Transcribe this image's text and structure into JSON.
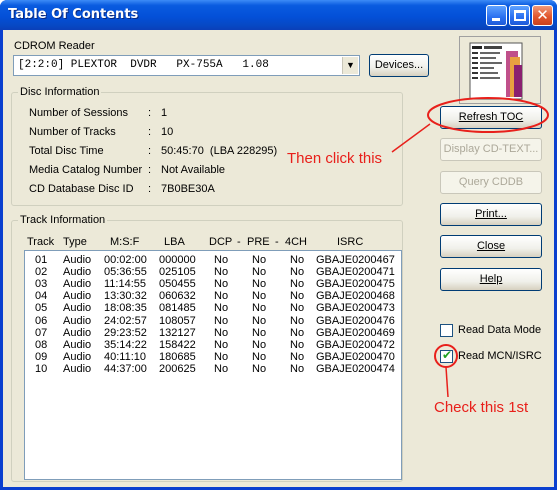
{
  "window": {
    "title": "Table Of Contents"
  },
  "cdrom": {
    "label": "CDROM Reader",
    "selected": "[2:2:0] PLEXTOR  DVDR   PX-755A   1.08",
    "devices_button": "Devices..."
  },
  "disc_info": {
    "title": "Disc Information",
    "rows": [
      {
        "label": "Number of Sessions",
        "sep": ":",
        "value": "1"
      },
      {
        "label": "Number of Tracks",
        "sep": ":",
        "value": "10"
      },
      {
        "label": "Total Disc Time",
        "sep": ":",
        "value": "50:45:70  (LBA 228295)"
      },
      {
        "label": "Media Catalog Number",
        "sep": ":",
        "value": "Not Available"
      },
      {
        "label": "CD Database Disc ID",
        "sep": ":",
        "value": "7B0BE30A"
      }
    ]
  },
  "track_info": {
    "title": "Track Information",
    "columns": {
      "track": "Track",
      "type": "Type",
      "msf": "M:S:F",
      "lba": "LBA",
      "dcp": "DCP",
      "dash1": "-",
      "pre": "PRE",
      "dash2": "-",
      "ch4": "4CH",
      "isrc": "ISRC"
    },
    "rows": [
      {
        "track": "01",
        "type": "Audio",
        "msf": "00:02:00",
        "lba": "000000",
        "dcp": "No",
        "pre": "No",
        "ch4": "No",
        "isrc": "GBAJE0200467"
      },
      {
        "track": "02",
        "type": "Audio",
        "msf": "05:36:55",
        "lba": "025105",
        "dcp": "No",
        "pre": "No",
        "ch4": "No",
        "isrc": "GBAJE0200471"
      },
      {
        "track": "03",
        "type": "Audio",
        "msf": "11:14:55",
        "lba": "050455",
        "dcp": "No",
        "pre": "No",
        "ch4": "No",
        "isrc": "GBAJE0200475"
      },
      {
        "track": "04",
        "type": "Audio",
        "msf": "13:30:32",
        "lba": "060632",
        "dcp": "No",
        "pre": "No",
        "ch4": "No",
        "isrc": "GBAJE0200468"
      },
      {
        "track": "05",
        "type": "Audio",
        "msf": "18:08:35",
        "lba": "081485",
        "dcp": "No",
        "pre": "No",
        "ch4": "No",
        "isrc": "GBAJE0200473"
      },
      {
        "track": "06",
        "type": "Audio",
        "msf": "24:02:57",
        "lba": "108057",
        "dcp": "No",
        "pre": "No",
        "ch4": "No",
        "isrc": "GBAJE0200476"
      },
      {
        "track": "07",
        "type": "Audio",
        "msf": "29:23:52",
        "lba": "132127",
        "dcp": "No",
        "pre": "No",
        "ch4": "No",
        "isrc": "GBAJE0200469"
      },
      {
        "track": "08",
        "type": "Audio",
        "msf": "35:14:22",
        "lba": "158422",
        "dcp": "No",
        "pre": "No",
        "ch4": "No",
        "isrc": "GBAJE0200472"
      },
      {
        "track": "09",
        "type": "Audio",
        "msf": "40:11:10",
        "lba": "180685",
        "dcp": "No",
        "pre": "No",
        "ch4": "No",
        "isrc": "GBAJE0200470"
      },
      {
        "track": "10",
        "type": "Audio",
        "msf": "44:37:00",
        "lba": "200625",
        "dcp": "No",
        "pre": "No",
        "ch4": "No",
        "isrc": "GBAJE0200474"
      }
    ]
  },
  "buttons": {
    "refresh_toc": "Refresh TOC",
    "display_cd_text": "Display CD-TEXT...",
    "query_cddb": "Query CDDB",
    "print": "Print...",
    "close": "Close",
    "help": "Help"
  },
  "options": {
    "read_data_mode": {
      "label": "Read Data Mode",
      "checked": false
    },
    "read_mcn_isrc": {
      "label": "Read MCN/ISRC",
      "checked": true
    }
  },
  "annotations": {
    "then_click": "Then click this",
    "check_first": "Check this 1st",
    "color": "#e8201b"
  },
  "icons": {
    "app": "toc-document-icon",
    "dropdown": "chevron-down-icon"
  }
}
